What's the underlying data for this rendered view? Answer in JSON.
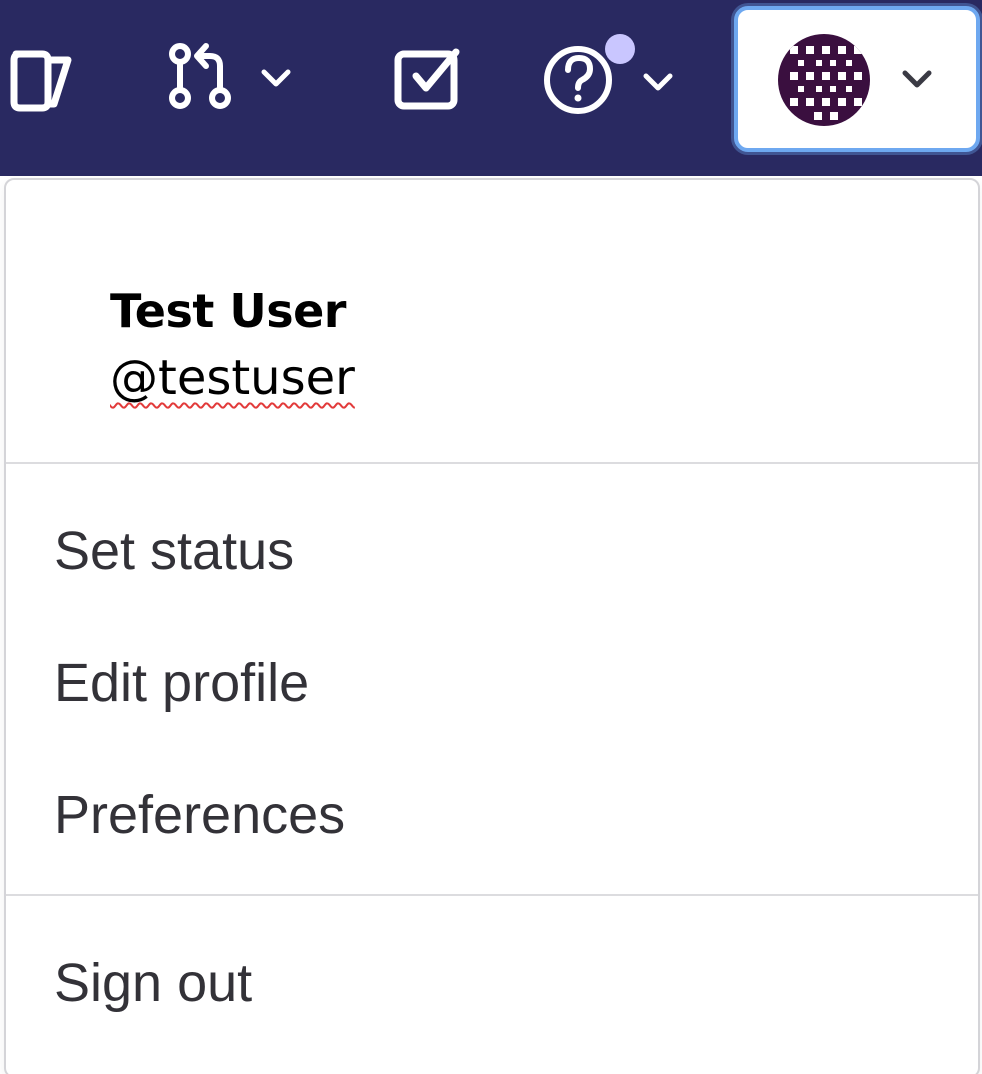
{
  "topbar": {
    "background": "#292961",
    "icons": {
      "issues": "issues-icon",
      "merge_requests": "merge-request-icon",
      "todos": "todo-icon",
      "help": "help-icon"
    },
    "help_notification_dot_color": "#c9c6ff"
  },
  "user_menu": {
    "name": "Test User",
    "username": "@testuser",
    "items": [
      {
        "label": "Set status"
      },
      {
        "label": "Edit profile"
      },
      {
        "label": "Preferences"
      }
    ],
    "sign_out_label": "Sign out"
  }
}
